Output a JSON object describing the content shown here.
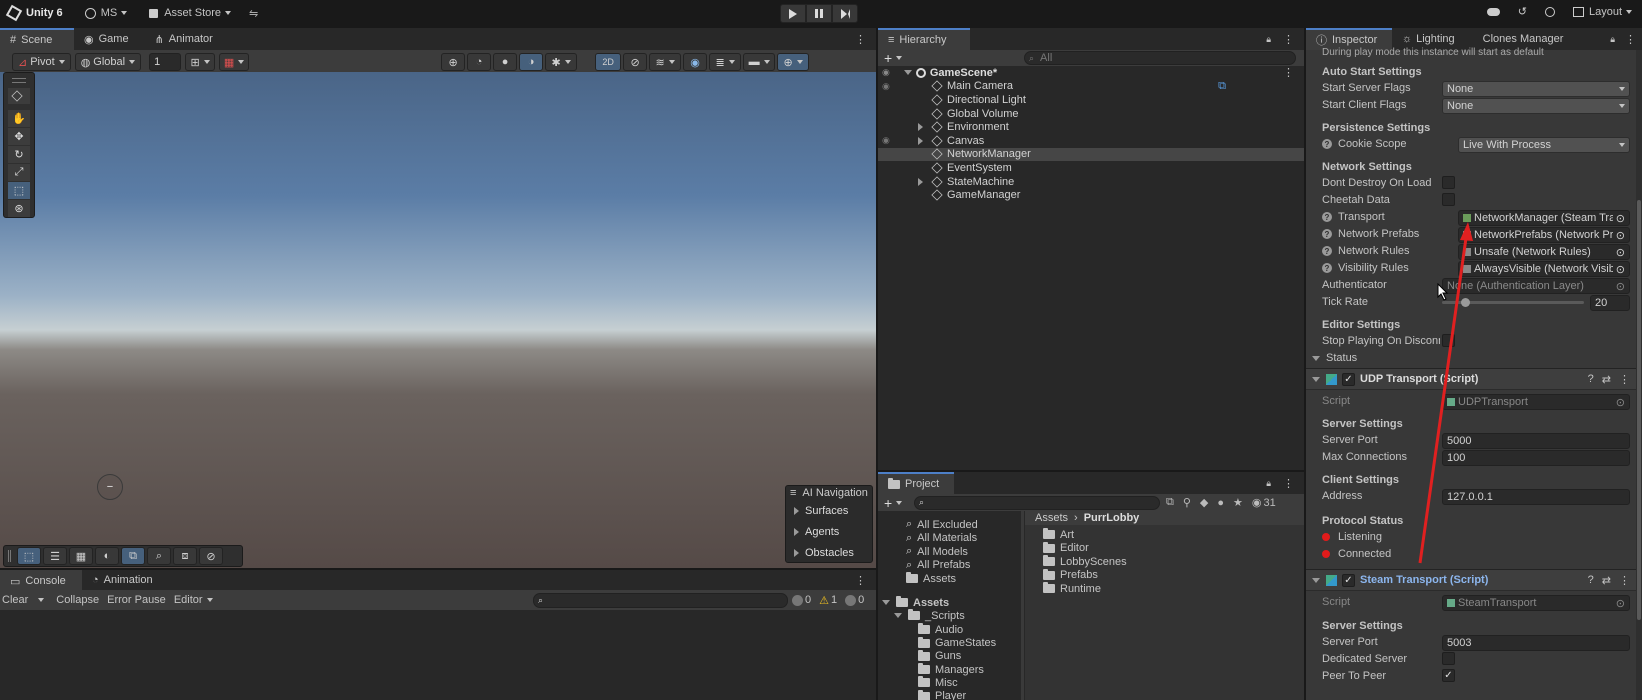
{
  "topbar": {
    "app": "Unity 6",
    "account": "MS",
    "store": "Asset Store",
    "layout": "Layout"
  },
  "scene": {
    "tabs": [
      "Scene",
      "Game",
      "Animator"
    ],
    "pivot": "Pivot",
    "global": "Global",
    "grid_value": "1",
    "mode2d": "2D",
    "overlay": {
      "title": "AI Navigation",
      "items": [
        "Surfaces",
        "Agents",
        "Obstacles"
      ]
    }
  },
  "console": {
    "tabs": [
      "Console",
      "Animation"
    ],
    "clear": "Clear",
    "collapse": "Collapse",
    "error_pause": "Error Pause",
    "editor": "Editor",
    "counts": {
      "info": "0",
      "warn": "1",
      "error": "0"
    }
  },
  "hierarchy": {
    "tab": "Hierarchy",
    "search_placeholder": "All",
    "scene": "GameScene*",
    "items": [
      {
        "label": "Main Camera",
        "expand": false
      },
      {
        "label": "Directional Light",
        "expand": false
      },
      {
        "label": "Global Volume",
        "expand": false
      },
      {
        "label": "Environment",
        "expand": true
      },
      {
        "label": "Canvas",
        "expand": true
      },
      {
        "label": "NetworkManager",
        "expand": false,
        "selected": true
      },
      {
        "label": "EventSystem",
        "expand": false
      },
      {
        "label": "StateMachine",
        "expand": true
      },
      {
        "label": "GameManager",
        "expand": false
      }
    ]
  },
  "project": {
    "tab": "Project",
    "hidden_count": "31",
    "favorites": [
      "All Excluded",
      "All Materials",
      "All Models",
      "All Prefabs",
      "Assets"
    ],
    "tree_root": "Assets",
    "scripts": "_Scripts",
    "tree": [
      "Audio",
      "GameStates",
      "Guns",
      "Managers",
      "Misc",
      "Player"
    ],
    "breadcrumb": [
      "Assets",
      "PurrLobby"
    ],
    "folders": [
      "Art",
      "Editor",
      "LobbyScenes",
      "Prefabs",
      "Runtime"
    ]
  },
  "inspector": {
    "tabs": [
      "Inspector",
      "Lighting",
      "Clones Manager"
    ],
    "cut_text": "During play mode this instance will start as default",
    "auto_start": {
      "title": "Auto Start Settings",
      "server_label": "Start Server Flags",
      "server_value": "None",
      "client_label": "Start Client Flags",
      "client_value": "None"
    },
    "persistence": {
      "title": "Persistence Settings",
      "cookie_label": "Cookie Scope",
      "cookie_value": "Live With Process"
    },
    "network": {
      "title": "Network Settings",
      "dont_destroy": "Dont Destroy On Load",
      "cheetah": "Cheetah Data",
      "transport_label": "Transport",
      "transport_value": "NetworkManager (Steam Transport)",
      "prefabs_label": "Network Prefabs",
      "prefabs_value": "NetworkPrefabs (Network Prefabs)",
      "rules_label": "Network Rules",
      "rules_value": "Unsafe (Network Rules)",
      "visibility_label": "Visibility Rules",
      "visibility_value": "AlwaysVisible (Network Visibility)",
      "auth_label": "Authenticator",
      "auth_value": "None (Authentication Layer)",
      "tick_label": "Tick Rate",
      "tick_value": "20",
      "tick_fraction": 0.16
    },
    "editor": {
      "title": "Editor Settings",
      "stop_label": "Stop Playing On Disconnect"
    },
    "status": "Status",
    "udp": {
      "title": "UDP Transport (Script)",
      "script_label": "Script",
      "script_value": "UDPTransport",
      "server_title": "Server Settings",
      "port_label": "Server Port",
      "port_value": "5000",
      "max_label": "Max Connections",
      "max_value": "100",
      "client_title": "Client Settings",
      "address_label": "Address",
      "address_value": "127.0.0.1",
      "protocol_title": "Protocol Status",
      "listening": "Listening",
      "connected": "Connected"
    },
    "steam": {
      "title": "Steam Transport (Script)",
      "script_label": "Script",
      "script_value": "SteamTransport",
      "server_title": "Server Settings",
      "port_label": "Server Port",
      "port_value": "5003",
      "dedicated_label": "Dedicated Server",
      "p2p_label": "Peer To Peer"
    }
  },
  "colors": {
    "accent": "#4d7fc7",
    "selected": "#2c5d87",
    "red": "#e21b1b",
    "arrow": "#e02020"
  }
}
